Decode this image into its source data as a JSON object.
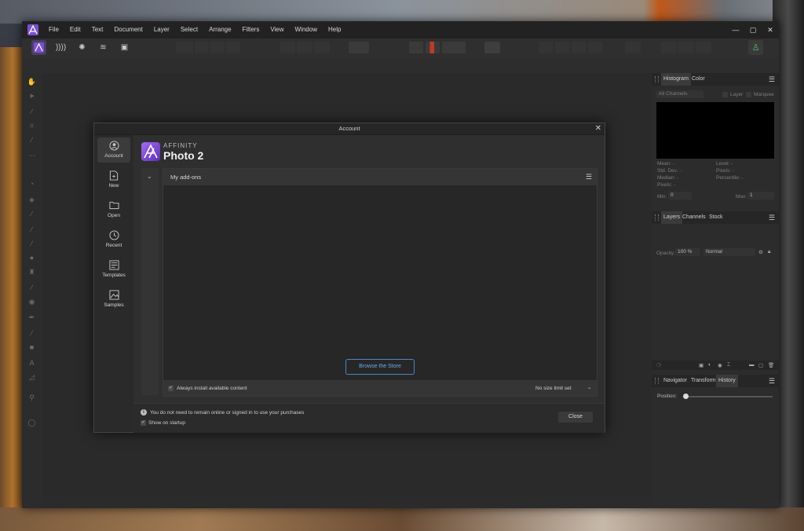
{
  "menubar": {
    "items": [
      "File",
      "Edit",
      "Text",
      "Document",
      "Layer",
      "Select",
      "Arrange",
      "Filters",
      "View",
      "Window",
      "Help"
    ],
    "window_controls": [
      "✕",
      "▢",
      "—"
    ]
  },
  "dialog": {
    "title": "Account",
    "sidebar": [
      {
        "label": "Account",
        "icon": "person-icon"
      },
      {
        "label": "New",
        "icon": "new-document-icon"
      },
      {
        "label": "Open",
        "icon": "folder-icon"
      },
      {
        "label": "Recent",
        "icon": "clock-icon"
      },
      {
        "label": "Templates",
        "icon": "templates-icon"
      },
      {
        "label": "Samples",
        "icon": "image-icon"
      }
    ],
    "brand": {
      "small": "AFFINITY",
      "big": "Photo 2"
    },
    "addons": {
      "title": "My add-ons",
      "browse": "Browse the Store",
      "always_install": "Always install available content",
      "size_limit": "No size limit set"
    },
    "info": "You do not need to remain online or signed in to use your purchases",
    "show_startup": "Show on startup",
    "close": "Close"
  },
  "panels": {
    "histogram": {
      "tabs": [
        "Histogram",
        "Color"
      ],
      "channels": "All Channels",
      "layer": "Layer",
      "marquee": "Marquee",
      "stats_left": [
        "Mean: -",
        "Std. Dev.: -",
        "Median: -",
        "Pixels: -"
      ],
      "stats_right": [
        "Level: -",
        "Pixels: -",
        "Percentile: -"
      ],
      "min_label": "Min:",
      "min_value": "0",
      "max_label": "Max:",
      "max_value": "1"
    },
    "layers": {
      "tabs": [
        "Layers",
        "Channels",
        "Stock"
      ],
      "opacity_label": "Opacity:",
      "opacity": "100 %",
      "blend": "Normal"
    },
    "history": {
      "tabs": [
        "Navigator",
        "Transform",
        "History"
      ],
      "position": "Position:"
    }
  },
  "colors": {
    "accent": "#7a4fd6",
    "link": "#4a86c7",
    "bg": "#2b2b2b"
  }
}
